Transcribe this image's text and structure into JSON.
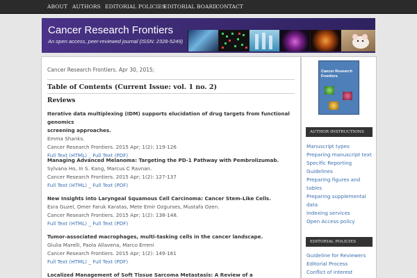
{
  "nav": [
    "ABOUT",
    "AUTHORS",
    "EDITORIAL POLICIES",
    "EDITORIAL BOARD",
    "CONTACT"
  ],
  "banner": {
    "title": "Cancer Research Frontiers",
    "subtitle": "An open access, peer-reviewed journal (ISSN: 2328-5249)"
  },
  "main": {
    "date_line": "Cancer Research Frontiers. Apr 30, 2015;",
    "toc_heading": "Table of Contents (Current Issue: vol. 1 no. 2)",
    "section": "Reviews",
    "articles": [
      {
        "title_l1": "Iterative data multiplexing (IDM) supports elucidation of drug targets from functional genomics",
        "title_l2": "screening approaches.",
        "authors": "Emma Shanks.",
        "citation": "Cancer Research Frontiers. 2015 Apr; 1(2): 119-126",
        "link_html": "Full Text (HTML)",
        "sep": "_",
        "link_pdf": "Full Text (PDF)"
      },
      {
        "title_l1": "Managing Advanced Melanoma: Targeting the PD-1 Pathway with Pembrolizumab.",
        "authors": "Sylvana Ho, In S. Kang, Marcus C Ravnan.",
        "citation": "Cancer Research Frontiers. 2015 Apr; 1(2): 127-137",
        "link_html": "Full Text (HTML)",
        "sep": "_",
        "link_pdf": "Full Text (PDF)"
      },
      {
        "title_l1": "New Insights into Laryngeal Squamous Cell Carcinoma: Cancer Stem-Like Cells.",
        "authors": "Esra Guzel, Omer Faruk Karatas, Mete Emir Ozgurses, Mustafa Ozen.",
        "citation": "Cancer Research Frontiers. 2015 Apr; 1(2): 138-148.",
        "link_html": "Full Text (HTML)",
        "sep": "_",
        "link_pdf": "Full Text (PDF)"
      },
      {
        "title_l1": "Tumor-associated macrophages, multi-tasking cells in the cancer landscape.",
        "authors": "Giulia Marelli, Paola Allavena, Marco Erreni",
        "citation": "Cancer Research Frontiers. 2015 Apr; 1(2): 149-161",
        "link_html": "Full Text (HTML)",
        "sep": "_",
        "link_pdf": "Full Text (PDF)"
      },
      {
        "title_l1": "Localized Management of Soft Tissue Sarcoma Metastasis: A Review of a Multidisciplinary"
      }
    ]
  },
  "sidebar": {
    "cover_title": "Cancer Research Frontiers",
    "author_instructions": {
      "heading": "AUTHOR INSTRUCTIONS",
      "links": [
        "Manuscript types",
        "Preparing manuscript text",
        "Specific Reporting",
        "Guidelines",
        "Preparing figures and",
        "tables",
        "Preparing supplemental",
        "data",
        "Indexing services",
        "Open Access policy"
      ]
    },
    "editorial_policies": {
      "heading": "EDITORIAL POLICIES",
      "links": [
        "Guideline for Reviewers",
        "Editorial Process",
        "Conflict of interest"
      ]
    }
  },
  "colors": {
    "nav_bg": "#2b2b2b",
    "banner_bg": "#3b2a6e",
    "link": "#3a6fb0",
    "widget_head": "#333333"
  }
}
